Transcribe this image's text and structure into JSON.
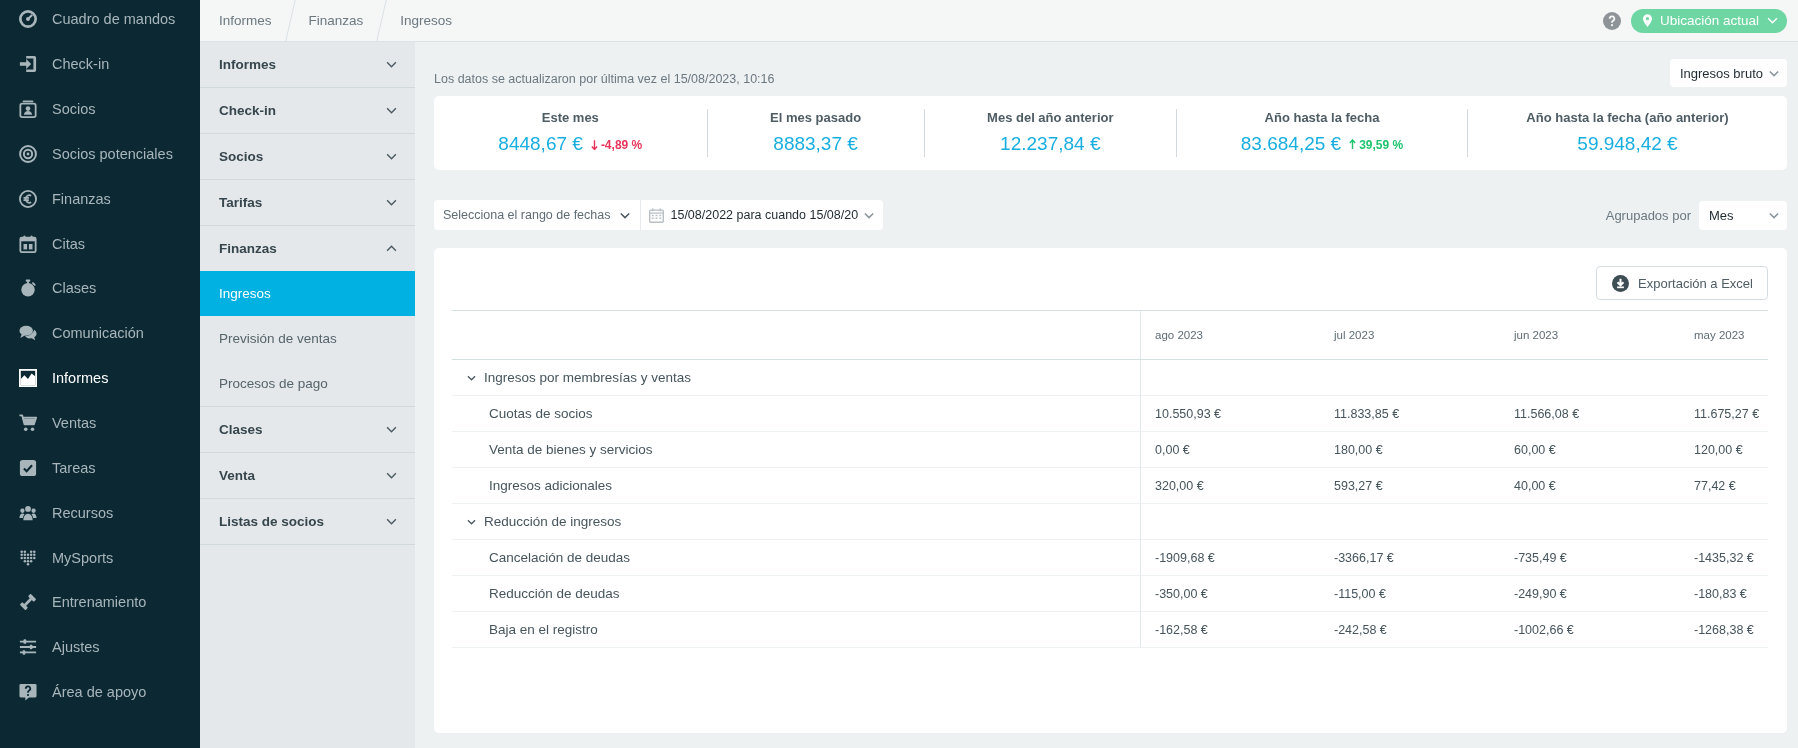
{
  "sidebar": {
    "items": [
      {
        "label": "Cuadro de mandos",
        "selected": false
      },
      {
        "label": "Check-in",
        "selected": false
      },
      {
        "label": "Socios",
        "selected": false
      },
      {
        "label": "Socios potenciales",
        "selected": false
      },
      {
        "label": "Finanzas",
        "selected": false
      },
      {
        "label": "Citas",
        "selected": false
      },
      {
        "label": "Clases",
        "selected": false
      },
      {
        "label": "Comunicación",
        "selected": false
      },
      {
        "label": "Informes",
        "selected": true
      },
      {
        "label": "Ventas",
        "selected": false
      },
      {
        "label": "Tareas",
        "selected": false
      },
      {
        "label": "Recursos",
        "selected": false
      },
      {
        "label": "MySports",
        "selected": false
      },
      {
        "label": "Entrenamiento",
        "selected": false
      },
      {
        "label": "Ajustes",
        "selected": false
      },
      {
        "label": "Área de apoyo",
        "selected": false
      }
    ]
  },
  "breadcrumb": [
    "Informes",
    "Finanzas",
    "Ingresos"
  ],
  "topbar": {
    "location": "Ubicación actual"
  },
  "subnav": {
    "items": [
      {
        "label": "Informes",
        "expanded": false
      },
      {
        "label": "Check-in",
        "expanded": false
      },
      {
        "label": "Socios",
        "expanded": false
      },
      {
        "label": "Tarifas",
        "expanded": false
      },
      {
        "label": "Finanzas",
        "expanded": true,
        "children": [
          {
            "label": "Ingresos",
            "selected": true
          },
          {
            "label": "Previsión de ventas",
            "selected": false
          },
          {
            "label": "Procesos de pago",
            "selected": false
          }
        ]
      },
      {
        "label": "Clases",
        "expanded": false
      },
      {
        "label": "Venta",
        "expanded": false
      },
      {
        "label": "Listas de socios",
        "expanded": false
      }
    ]
  },
  "updated_text": "Los datos se actualizaron por última vez el 15/08/2023, 10:16",
  "revenue_type": {
    "value": "Ingresos bruto"
  },
  "kpis": [
    {
      "label": "Este mes",
      "value": "8448,67 €",
      "change": {
        "increase": false,
        "text": "-4,89 %"
      }
    },
    {
      "label": "El mes pasado",
      "value": "8883,37 €"
    },
    {
      "label": "Mes del año anterior",
      "value": "12.237,84 €"
    },
    {
      "label": "Año hasta la fecha",
      "value": "83.684,25 €",
      "change": {
        "increase": true,
        "text": "39,59 %"
      }
    },
    {
      "label": "Año hasta la fecha (año anterior)",
      "value": "59.948,42 €"
    }
  ],
  "filters": {
    "range": {
      "placeholder": "Selecciona el rango de fechas"
    },
    "dates": {
      "value": "15/08/2022 para cuando 15/08/20"
    },
    "group_by": {
      "label": "Agrupados por",
      "value": "Mes"
    }
  },
  "table": {
    "export_button": "Exportación a Excel",
    "columns": [
      "ago 2023",
      "jul 2023",
      "jun 2023",
      "may 2023"
    ],
    "groups": [
      {
        "label": "Ingresos por membresías y ventas",
        "expanded": true,
        "children": [
          {
            "label": "Cuotas de socios",
            "values": [
              "10.550,93 €",
              "11.833,85 €",
              "11.566,08 €",
              "11.675,27 €"
            ]
          },
          {
            "label": "Venta de bienes y servicios",
            "values": [
              "0,00 €",
              "180,00 €",
              "60,00 €",
              "120,00 €"
            ]
          },
          {
            "label": "Ingresos adicionales",
            "values": [
              "320,00 €",
              "593,27 €",
              "40,00 €",
              "77,42 €"
            ]
          }
        ]
      },
      {
        "label": "Reducción de ingresos",
        "expanded": true,
        "children": [
          {
            "label": "Cancelación de deudas",
            "values": [
              "-1909,68 €",
              "-3366,17 €",
              "-735,49 €",
              "-1435,32 €"
            ]
          },
          {
            "label": "Reducción de deudas",
            "values": [
              "-350,00 €",
              "-115,00 €",
              "-249,90 €",
              "-180,83 €"
            ]
          },
          {
            "label": "Baja en el registro",
            "values": [
              "-162,58 €",
              "-242,58 €",
              "-1002,66 €",
              "-1268,38 €"
            ]
          }
        ]
      }
    ]
  }
}
